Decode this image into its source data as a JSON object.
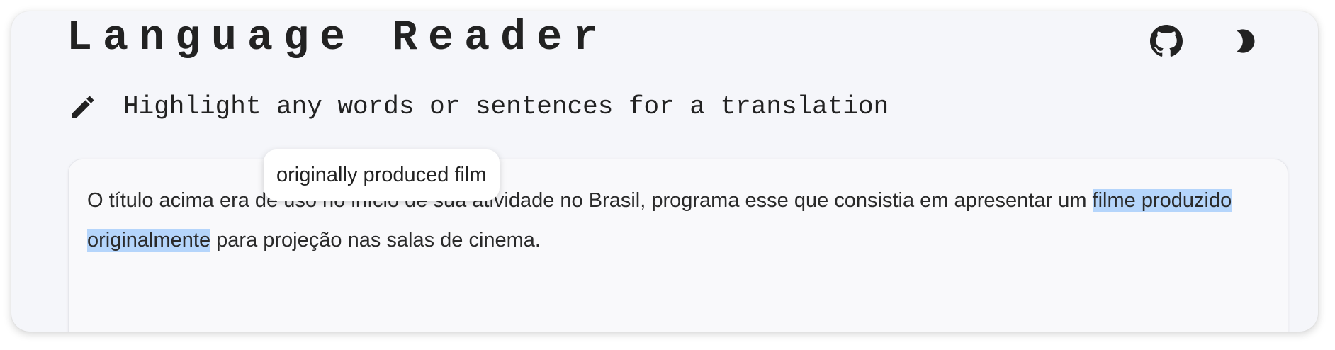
{
  "app": {
    "title": "Language Reader"
  },
  "header": {
    "icons": {
      "github": "github-icon",
      "theme": "moon-icon"
    }
  },
  "subtitle": {
    "icon": "pencil-icon",
    "text": "Highlight any words or sentences for a translation"
  },
  "reader": {
    "text_before": "O título acima era de uso no início de sua atividade no Brasil, programa esse que consistia em apresentar um ",
    "highlighted": "filme produzido originalmente",
    "text_after": " para projeção nas salas de cinema."
  },
  "tooltip": {
    "translation": "originally produced film"
  },
  "colors": {
    "background": "#f5f6fa",
    "card": "#f9f9fb",
    "highlight": "#b5d5fb",
    "text": "#222222"
  }
}
